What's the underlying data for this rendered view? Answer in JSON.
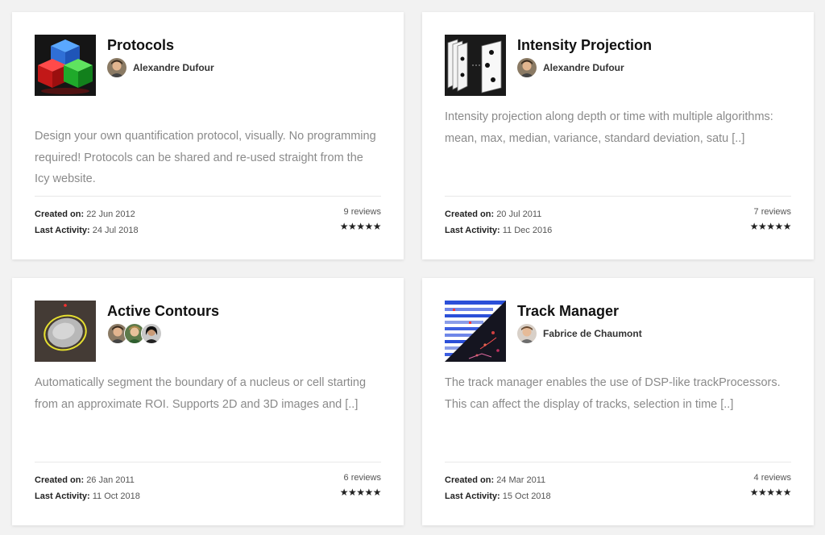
{
  "plugins": [
    {
      "title": "Protocols",
      "authors": [
        "Alexandre Dufour"
      ],
      "author_label": "Alexandre Dufour",
      "description": "Design your own quantification protocol, visually. No programming required! Protocols can be shared and re-used straight from the Icy website.",
      "created_label": "Created on:",
      "created": "22 Jun 2012",
      "activity_label": "Last Activity:",
      "activity": "24 Jul 2018",
      "reviews": "9 reviews",
      "rating": 5,
      "stars": "★★★★★"
    },
    {
      "title": "Intensity Projection",
      "authors": [
        "Alexandre Dufour"
      ],
      "author_label": "Alexandre Dufour",
      "description": "Intensity projection along depth or time with multiple algorithms: mean, max, median, variance, standard deviation, satu [..]",
      "created_label": "Created on:",
      "created": "20 Jul 2011",
      "activity_label": "Last Activity:",
      "activity": "11 Dec 2016",
      "reviews": "7 reviews",
      "rating": 5,
      "stars": "★★★★★"
    },
    {
      "title": "Active Contours",
      "authors": [],
      "author_label": "",
      "description": "Automatically segment the boundary of a nucleus or cell starting from an approximate ROI. Supports 2D and 3D images and [..]",
      "created_label": "Created on:",
      "created": "26 Jan 2011",
      "activity_label": "Last Activity:",
      "activity": "11 Oct 2018",
      "reviews": "6 reviews",
      "rating": 5,
      "stars": "★★★★★"
    },
    {
      "title": "Track Manager",
      "authors": [
        "Fabrice de Chaumont"
      ],
      "author_label": "Fabrice de Chaumont",
      "description": "The track manager enables the use of DSP-like trackProcessors. This can affect the display of tracks, selection in time [..]",
      "created_label": "Created on:",
      "created": "24 Mar 2011",
      "activity_label": "Last Activity:",
      "activity": "15 Oct 2018",
      "reviews": "4 reviews",
      "rating": 5,
      "stars": "★★★★★"
    }
  ],
  "colors": {
    "background": "#f2f2f2",
    "card": "#ffffff",
    "title": "#111111",
    "description": "#8a8a8a",
    "stars": "#222222"
  }
}
